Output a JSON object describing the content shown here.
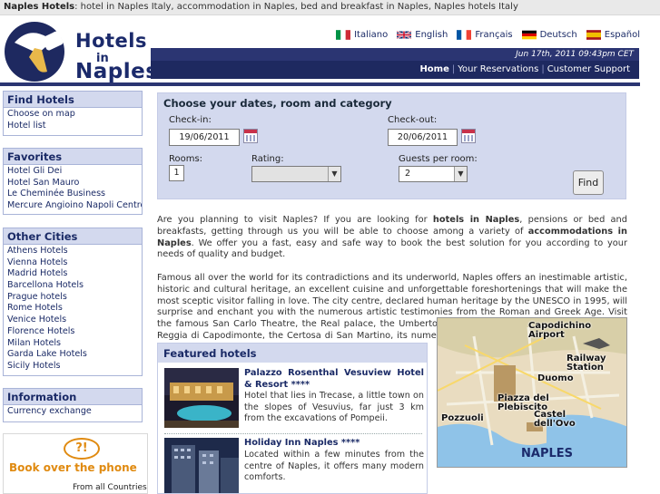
{
  "topbar": {
    "brand": "Naples Hotels",
    "tagline": ": hotel in Naples Italy, accommodation in Naples, bed and breakfast in Naples, Naples hotels Italy"
  },
  "logo": {
    "line1": "Hotels",
    "line2": "in",
    "line3": "Naples"
  },
  "languages": [
    {
      "label": "Italiano",
      "flag": "flag-italy"
    },
    {
      "label": "English",
      "flag": "flag-uk"
    },
    {
      "label": "Français",
      "flag": "flag-france"
    },
    {
      "label": "Deutsch",
      "flag": "flag-germany"
    },
    {
      "label": "Español",
      "flag": "flag-spain"
    }
  ],
  "datetime": "Jun 17th, 2011 09:43pm CET",
  "nav": {
    "home": "Home",
    "reservations": "Your Reservations",
    "support": "Customer Support",
    "separator": "|"
  },
  "sidebar": {
    "find_hotels": {
      "title": "Find Hotels",
      "items": [
        "Choose on map",
        "Hotel list"
      ]
    },
    "favorites": {
      "title": "Favorites",
      "items": [
        "Hotel Gli Dei",
        "Hotel San Mauro",
        "Le Cheminée Business",
        "Mercure Angioino Napoli Centro"
      ]
    },
    "other_cities": {
      "title": "Other Cities",
      "items": [
        "Athens Hotels",
        "Vienna Hotels",
        "Madrid Hotels",
        "Barcellona Hotels",
        "Prague hotels",
        "Rome Hotels",
        "Venice Hotels",
        "Florence Hotels",
        "Milan Hotels",
        "Garda Lake Hotels",
        "Sicily Hotels"
      ]
    },
    "information": {
      "title": "Information",
      "items": [
        "Currency exchange"
      ]
    },
    "phone_banner": {
      "bubble": "?!",
      "title": "Book over the phone",
      "subtitle": "From all Countries"
    }
  },
  "search": {
    "title": "Choose your dates, room and category",
    "checkin_label": "Check-in:",
    "checkin_value": "19/06/2011",
    "checkout_label": "Check-out:",
    "checkout_value": "20/06/2011",
    "rooms_label": "Rooms:",
    "rooms_value": "1",
    "rating_label": "Rating:",
    "rating_value": "",
    "guests_label": "Guests per room:",
    "guests_value": "2",
    "find_label": "Find"
  },
  "intro": {
    "p1_a": "Are you planning to visit Naples? If you are looking for ",
    "p1_b": "hotels in Naples",
    "p1_c": ", pensions or bed and breakfasts, getting through us you will be able to choose among a variety of ",
    "p1_d": "accommodations in Naples",
    "p1_e": ". We offer you a fast, easy and safe way to book the best solution for you according to your needs of quality and budget.",
    "p2": "Famous all over the world for its contradictions and its underworld, Naples offers an inestimable artistic, historic and cultural heritage, an excellent cuisine and unforgettable foreshortenings that will make the most sceptic visitor falling in love. The city centre, declared human heritage by the UNESCO in 1995, will surprise and enchant you with the numerous artistic testimonies from the Roman and Greek Age. Visit the famous San Carlo Theatre, the Real palace, the Umberto Gallery, the Archaeological Museum, the Reggia di Capodimonte, the Certosa di San Martino, its numerous churches, the Roman catacombs and its surroundings with Pompeii and Mont Vesuvius ruins."
  },
  "featured": {
    "title": "Featured hotels",
    "hotels": [
      {
        "name": "Palazzo Rosenthal Vesuview Hotel & Resort",
        "stars": "****",
        "desc": "Hotel that lies in Trecase, a little town on the slopes of Vesuvius, far just 3 km from the excavations of Pompeii."
      },
      {
        "name": "Holiday Inn Naples",
        "stars": "****",
        "desc": "Located within a few minutes from the centre of Naples, it offers many modern comforts."
      }
    ]
  },
  "map": {
    "labels": [
      "Capodichino Airport",
      "Railway Station",
      "Duomo",
      "Piazza del Plebiscito",
      "Pozzuoli",
      "Castel dell'Ovo"
    ],
    "city": "NAPLES"
  },
  "colors": {
    "brand_navy": "#1e2960",
    "panel_blue": "#d3d9ee",
    "accent_orange": "#e08a10"
  }
}
